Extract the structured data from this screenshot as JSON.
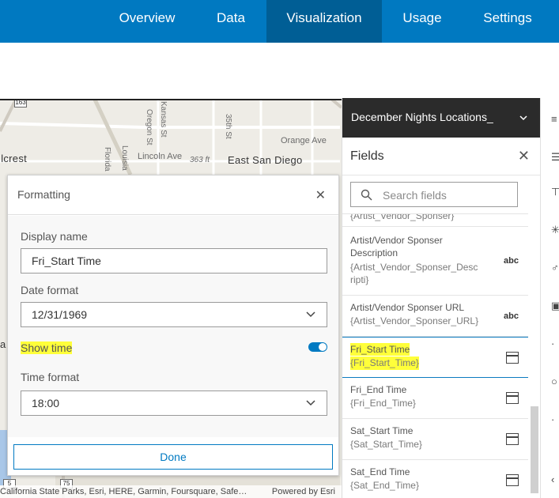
{
  "nav": {
    "tabs": [
      {
        "label": "Overview"
      },
      {
        "label": "Data"
      },
      {
        "label": "Visualization"
      },
      {
        "label": "Usage"
      },
      {
        "label": "Settings"
      }
    ],
    "active_tab": "Visualization"
  },
  "map": {
    "labels": {
      "hillcrest": "llcrest",
      "lincoln_ave": "Lincoln Ave",
      "elevation": "363 ft",
      "east_san_diego": "East San Diego",
      "orange_ave": "Orange Ave",
      "oregon_st": "Oregon St",
      "kansas_st": "Kansas St",
      "35th_st": "35th St",
      "florida": "Florida",
      "louisiana": "Louisia",
      "fragment_a": "a"
    },
    "shields": {
      "top": "163",
      "bottom_a": "5",
      "bottom_b": "75"
    },
    "attribution_left": "California State Parks, Esri, HERE, Garmin, Foursquare, Safe…",
    "attribution_right": "Powered by Esri"
  },
  "formatting": {
    "title": "Formatting",
    "display_name_label": "Display name",
    "display_name_value": "Fri_Start Time",
    "date_format_label": "Date format",
    "date_format_value": "12/31/1969",
    "show_time_label": "Show time",
    "show_time_on": true,
    "time_format_label": "Time format",
    "time_format_value": "18:00",
    "done_label": "Done"
  },
  "panel": {
    "layer_name": "December Nights Locations_",
    "fields_title": "Fields",
    "search_placeholder": "Search fields",
    "partial_top": "{Artist_Vendor_Sponser}",
    "items": [
      {
        "name_line1": "Artist/Vendor Sponser",
        "name_line2": "Description",
        "expr_line1": "{Artist_Vendor_Sponser_Desc",
        "expr_line2": "ripti}",
        "type": "abc"
      },
      {
        "name_line1": "Artist/Vendor Sponser URL",
        "expr_line1": "{Artist_Vendor_Sponser_URL}",
        "type": "abc"
      },
      {
        "name_line1": "Fri_Start Time",
        "expr_line1": "{Fri_Start_Time}",
        "type": "date"
      },
      {
        "name_line1": "Fri_End Time",
        "expr_line1": "{Fri_End_Time}",
        "type": "date"
      },
      {
        "name_line1": "Sat_Start Time",
        "expr_line1": "{Sat_Start_Time}",
        "type": "date"
      },
      {
        "name_line1": "Sat_End Time",
        "expr_line1": "{Sat_End_Time}",
        "type": "date"
      }
    ]
  },
  "colors": {
    "brand_blue": "#0079c1",
    "active_tab": "#005e95",
    "highlight": "#ffff3a",
    "layer_header": "#2b2b2b"
  }
}
